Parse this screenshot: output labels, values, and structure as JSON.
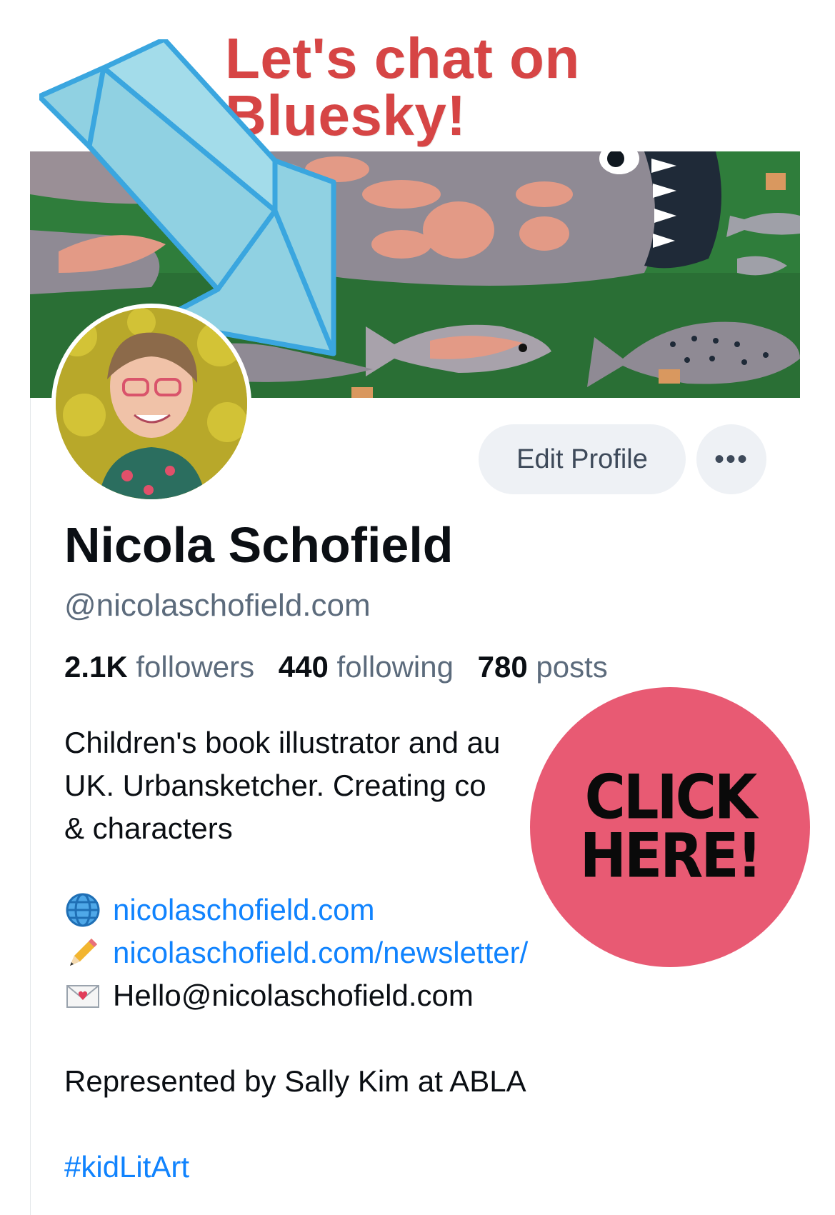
{
  "promo": {
    "title": "Let's chat on Bluesky!",
    "cta_line1": "CLICK",
    "cta_line2": "HERE!",
    "cta_color": "#e85a73",
    "title_color": "#d64545"
  },
  "profile": {
    "display_name": "Nicola Schofield",
    "handle": "@nicolaschofield.com",
    "edit_button_label": "Edit Profile",
    "more_button_label": "•••",
    "stats": {
      "followers_count": "2.1K",
      "followers_label": "followers",
      "following_count": "440",
      "following_label": "following",
      "posts_count": "780",
      "posts_label": "posts"
    },
    "bio_lines": [
      "Children's book illustrator and au",
      "UK. Urbansketcher. Creating co",
      "& characters"
    ],
    "links": [
      {
        "icon": "globe-icon",
        "text": "nicolaschofield.com"
      },
      {
        "icon": "pencil-icon",
        "text": "nicolaschofield.com/newsletter/"
      },
      {
        "icon": "love-letter-icon",
        "text": "Hello@nicolaschofield.com"
      }
    ],
    "represented": "Represented by Sally Kim at ABLA",
    "hashtag": "#kidLitArt"
  },
  "colors": {
    "link": "#1083fe",
    "muted": "#5c6b7c",
    "button_bg": "#eef1f5",
    "arrow_fill": "#a3dcea",
    "arrow_stroke": "#3aa6df"
  }
}
